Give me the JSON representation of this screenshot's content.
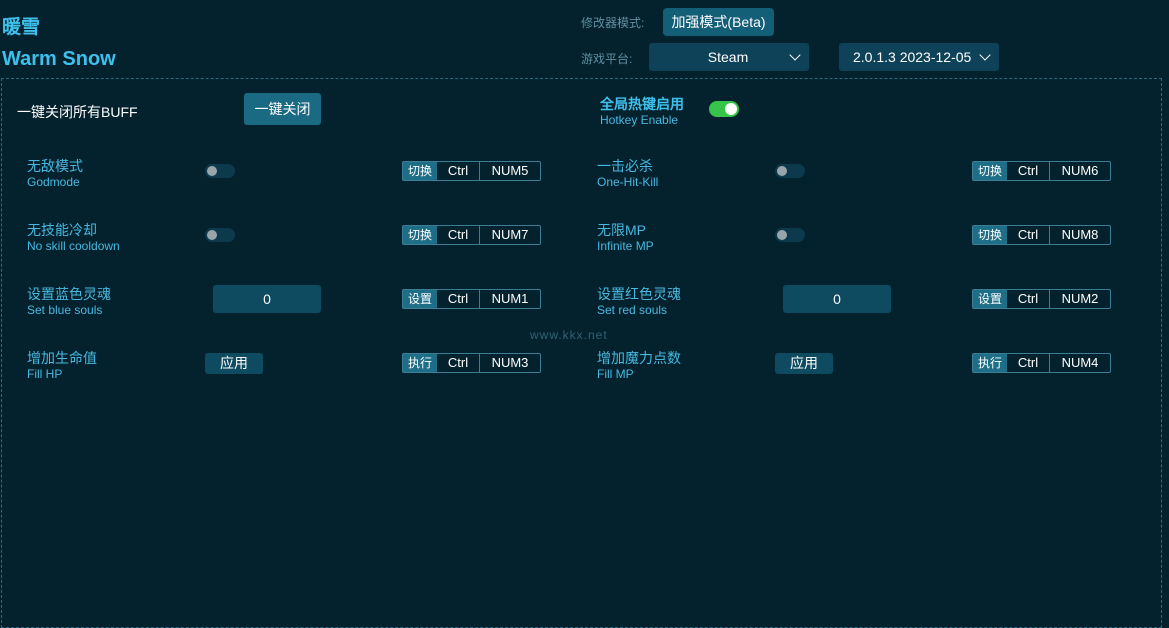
{
  "app": {
    "title_cn": "暖雪",
    "title_en": "Warm Snow"
  },
  "header": {
    "mode_label": "修改器模式:",
    "mode_button": "加强模式(Beta)",
    "platform_label": "游戏平台:",
    "platform_value": "Steam",
    "version_value": "2.0.1.3 2023-12-05"
  },
  "top": {
    "close_all_label": "一键关闭所有BUFF",
    "close_all_button": "一键关闭",
    "hotkey_cn": "全局热键启用",
    "hotkey_en": "Hotkey Enable"
  },
  "options": [
    {
      "cn": "无敌模式",
      "en": "Godmode",
      "action": "切换",
      "k1": "Ctrl",
      "k2": "NUM5"
    },
    {
      "cn": "一击必杀",
      "en": "One-Hit-Kill",
      "action": "切换",
      "k1": "Ctrl",
      "k2": "NUM6"
    },
    {
      "cn": "无技能冷却",
      "en": "No skill cooldown",
      "action": "切换",
      "k1": "Ctrl",
      "k2": "NUM7"
    },
    {
      "cn": "无限MP",
      "en": "Infinite MP",
      "action": "切换",
      "k1": "Ctrl",
      "k2": "NUM8"
    },
    {
      "cn": "设置蓝色灵魂",
      "en": "Set blue souls",
      "value": "0",
      "action": "设置",
      "k1": "Ctrl",
      "k2": "NUM1"
    },
    {
      "cn": "设置红色灵魂",
      "en": "Set red souls",
      "value": "0",
      "action": "设置",
      "k1": "Ctrl",
      "k2": "NUM2"
    },
    {
      "cn": "增加生命值",
      "en": "Fill HP",
      "button": "应用",
      "action": "执行",
      "k1": "Ctrl",
      "k2": "NUM3"
    },
    {
      "cn": "增加魔力点数",
      "en": "Fill MP",
      "button": "应用",
      "action": "执行",
      "k1": "Ctrl",
      "k2": "NUM4"
    }
  ],
  "watermark": "www.kkx.net"
}
